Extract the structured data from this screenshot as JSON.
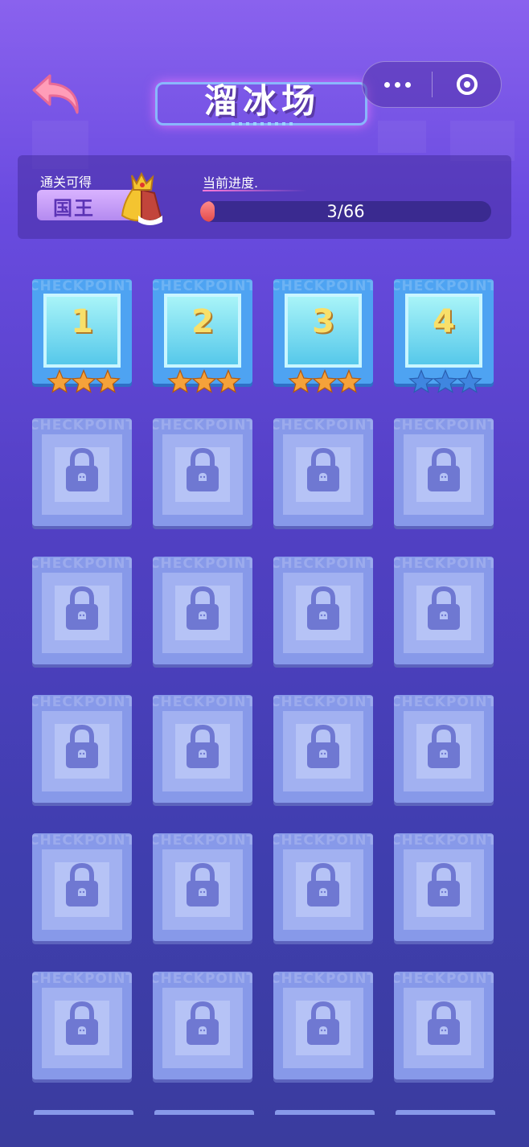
{
  "header": {
    "title": "溜冰场"
  },
  "reward": {
    "label": "通关可得",
    "prize": "国王"
  },
  "progress": {
    "label": "当前进度.",
    "text": "3/66",
    "fraction": 0.0455
  },
  "level_watermark": "CHECKPOINT",
  "levels": [
    {
      "number": "1",
      "stars_earned": 3,
      "locked": false
    },
    {
      "number": "2",
      "stars_earned": 3,
      "locked": false
    },
    {
      "number": "3",
      "stars_earned": 3,
      "locked": false
    },
    {
      "number": "4",
      "stars_earned": 0,
      "locked": false
    },
    {
      "number": "",
      "stars_earned": 0,
      "locked": true
    },
    {
      "number": "",
      "stars_earned": 0,
      "locked": true
    },
    {
      "number": "",
      "stars_earned": 0,
      "locked": true
    },
    {
      "number": "",
      "stars_earned": 0,
      "locked": true
    },
    {
      "number": "",
      "stars_earned": 0,
      "locked": true
    },
    {
      "number": "",
      "stars_earned": 0,
      "locked": true
    },
    {
      "number": "",
      "stars_earned": 0,
      "locked": true
    },
    {
      "number": "",
      "stars_earned": 0,
      "locked": true
    },
    {
      "number": "",
      "stars_earned": 0,
      "locked": true
    },
    {
      "number": "",
      "stars_earned": 0,
      "locked": true
    },
    {
      "number": "",
      "stars_earned": 0,
      "locked": true
    },
    {
      "number": "",
      "stars_earned": 0,
      "locked": true
    },
    {
      "number": "",
      "stars_earned": 0,
      "locked": true
    },
    {
      "number": "",
      "stars_earned": 0,
      "locked": true
    },
    {
      "number": "",
      "stars_earned": 0,
      "locked": true
    },
    {
      "number": "",
      "stars_earned": 0,
      "locked": true
    },
    {
      "number": "",
      "stars_earned": 0,
      "locked": true
    },
    {
      "number": "",
      "stars_earned": 0,
      "locked": true
    },
    {
      "number": "",
      "stars_earned": 0,
      "locked": true
    },
    {
      "number": "",
      "stars_earned": 0,
      "locked": true
    }
  ],
  "colors": {
    "star_earned": "#f5a23a",
    "star_empty": "#3f86e0",
    "accent": "#ff8a8a"
  }
}
